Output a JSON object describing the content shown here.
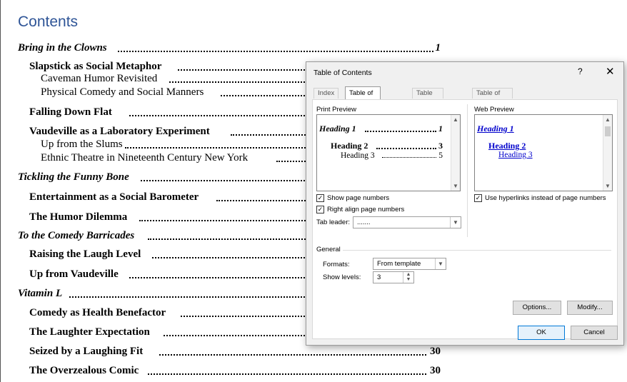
{
  "document": {
    "title": "Contents",
    "toc": [
      {
        "text": "Bring in the Clowns",
        "page": "1"
      },
      {
        "text": "Slapstick as Social Metaphor",
        "page": ""
      },
      {
        "text": "Caveman Humor Revisited",
        "page": ""
      },
      {
        "text": "Physical Comedy and Social Manners",
        "page": ""
      },
      {
        "text": "Falling Down Flat",
        "page": ""
      },
      {
        "text": "Vaudeville as a Laboratory Experiment",
        "page": ""
      },
      {
        "text": "Up from the Slums",
        "page": ""
      },
      {
        "text": "Ethnic Theatre in Nineteenth Century New York",
        "page": ""
      },
      {
        "text": "Tickling the Funny Bone",
        "page": ""
      },
      {
        "text": "Entertainment as a Social Barometer",
        "page": ""
      },
      {
        "text": "The Humor Dilemma",
        "page": ""
      },
      {
        "text": "To the Comedy Barricades",
        "page": ""
      },
      {
        "text": "Raising the Laugh Level",
        "page": ""
      },
      {
        "text": "Up from Vaudeville",
        "page": ""
      },
      {
        "text": "Vitamin L",
        "page": ""
      },
      {
        "text": "Comedy as Health Benefactor",
        "page": ""
      },
      {
        "text": "The Laughter Expectation",
        "page": ""
      },
      {
        "text": "Seized by a Laughing Fit",
        "page": "30"
      },
      {
        "text": "The Overzealous Comic",
        "page": "30"
      }
    ]
  },
  "dialog": {
    "title": "Table of Contents",
    "help": "?",
    "close": "✕",
    "tabs": [
      "Index",
      "Table of Contents",
      "Table of Figures",
      "Table of Authorities"
    ],
    "print_preview": {
      "label": "Print Preview",
      "h1": "Heading 1",
      "h1_page": "1",
      "h2": "Heading 2",
      "h2_page": "3",
      "h3": "Heading 3",
      "h3_page": "5"
    },
    "web_preview": {
      "label": "Web Preview",
      "h1": "Heading 1",
      "h2": "Heading 2",
      "h3": "Heading 3"
    },
    "show_page_numbers": {
      "label": "Show page numbers",
      "checked": true
    },
    "right_align": {
      "label": "Right align page numbers",
      "checked": true
    },
    "hyperlinks": {
      "label": "Use hyperlinks instead of page numbers",
      "checked": true
    },
    "tab_leader": {
      "label": "Tab leader:",
      "value": "......."
    },
    "general": {
      "label": "General",
      "formats_label": "Formats:",
      "formats_value": "From template",
      "levels_label": "Show levels:",
      "levels_value": "3"
    },
    "buttons": {
      "options": "Options...",
      "modify": "Modify...",
      "ok": "OK",
      "cancel": "Cancel"
    }
  }
}
